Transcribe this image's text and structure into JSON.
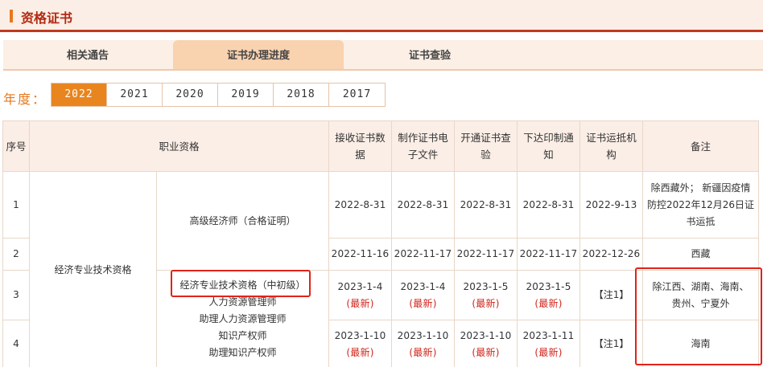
{
  "section_title": "资格证书",
  "tabs": [
    {
      "label": "相关通告"
    },
    {
      "label": "证书办理进度"
    },
    {
      "label": "证书查验"
    }
  ],
  "year_label": "年度：",
  "years": [
    "2022",
    "2021",
    "2020",
    "2019",
    "2018",
    "2017"
  ],
  "table": {
    "headers": {
      "seq": "序号",
      "qualification": "职业资格",
      "receive_line1": "接收证书数",
      "receive_line2": "据",
      "make_line1": "制作证书电",
      "make_line2": "子文件",
      "open_line1": "开通证书查",
      "open_line2": "验",
      "print_line1": "下达印制通",
      "print_line2": "知",
      "ship_line1": "证书运抵机",
      "ship_line2": "构",
      "remark": "备注"
    },
    "group_name": "经济专业技术资格",
    "rows": [
      {
        "seq": "1",
        "dates": [
          "2022-8-31",
          "2022-8-31",
          "2022-8-31",
          "2022-8-31",
          "2022-9-13"
        ],
        "remark_lines": [
          "除西藏外； 新疆因疫情",
          "防控2022年12月26日证",
          "书运抵"
        ]
      },
      {
        "seq": "2",
        "dates": [
          "2022-11-16",
          "2022-11-17",
          "2022-11-17",
          "2022-11-17",
          "2022-12-26"
        ],
        "remark": "西藏"
      },
      {
        "seq": "3",
        "dates": [
          "2023-1-4",
          "2023-1-4",
          "2023-1-5",
          "2023-1-5"
        ],
        "ship": "【注1】",
        "remark_lines": [
          "除江西、湖南、海南、",
          "贵州、宁夏外"
        ]
      },
      {
        "seq": "4",
        "dates": [
          "2023-1-10",
          "2023-1-10",
          "2023-1-10",
          "2023-1-11"
        ],
        "ship": "【注1】",
        "remark": "海南"
      }
    ],
    "qualifications": {
      "senior_economist": "高级经济师（合格证明）",
      "mid_junior_economist": "经济专业技术资格（中初级）",
      "hr_manager": "人力资源管理师",
      "assistant_hr_manager": "助理人力资源管理师",
      "ip_officer": "知识产权师",
      "assistant_ip_officer": "助理知识产权师"
    },
    "new_tag": "(最新)"
  },
  "colors": {
    "accent": "#e8851f",
    "title_red": "#b22a12",
    "new_red": "#d0261b",
    "highlight": "#e0231a"
  }
}
